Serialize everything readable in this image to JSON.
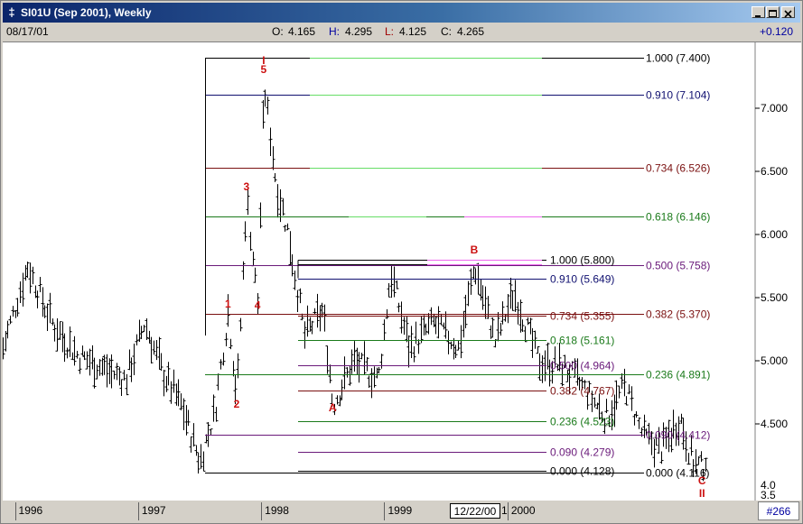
{
  "window": {
    "icon_glyph": "‡",
    "title": "SI01U (Sep 2001), Weekly",
    "buttons": [
      "minimize",
      "maximize",
      "close"
    ]
  },
  "status": {
    "date": "08/17/01",
    "open_label": "O:",
    "open": "4.165",
    "high_label": "H:",
    "high": "4.295",
    "low_label": "L:",
    "low": "4.125",
    "close_label": "C:",
    "close": "4.265",
    "change": "+0.120"
  },
  "bottom": {
    "years": [
      "1996",
      "1997",
      "1998",
      "1999",
      "2000"
    ],
    "cursor_date": "12/22/00",
    "after_cursor": "1",
    "bar_count": "#266"
  },
  "colors": {
    "fib_green": "#1a7a1a",
    "fib_purple": "#6a1a7a",
    "fib_maroon": "#7a1010",
    "fib_navy": "#101070",
    "wave_label": "#cc1010",
    "highlight_green": "#66dd66",
    "highlight_magenta": "#ee66ee"
  },
  "chart_data": {
    "type": "ohlc",
    "ylim": [
      4.0,
      7.4
    ],
    "y_ticks": [
      "7.000",
      "6.500",
      "6.000",
      "5.500",
      "5.000",
      "4.500"
    ],
    "y_tick_values": [
      7.0,
      6.5,
      6.0,
      5.5,
      5.0,
      4.5
    ],
    "y_bottom_cut": [
      "4.0",
      "3.5"
    ],
    "x_labels": [
      "1996",
      "1997",
      "1998",
      "1999",
      "2000",
      "12/22/00"
    ],
    "wave_labels": [
      {
        "text": "1",
        "date": "1997.73",
        "price": 5.42
      },
      {
        "text": "2",
        "date": "1997.80",
        "price": 4.63
      },
      {
        "text": "3",
        "date": "1997.88",
        "price": 6.35
      },
      {
        "text": "4",
        "date": "1997.97",
        "price": 5.41
      },
      {
        "text": "5",
        "date": "1998.02",
        "price": 7.28
      },
      {
        "text": "I",
        "date": "1998.02",
        "price": 7.35
      },
      {
        "text": "A",
        "date": "1998.58",
        "price": 4.6
      },
      {
        "text": "B",
        "date": "1999.73",
        "price": 5.85
      },
      {
        "text": "C",
        "date": "2001.58",
        "price": 4.02
      },
      {
        "text": "II",
        "date": "2001.58",
        "price": 3.92
      }
    ],
    "fib_set_major": [
      {
        "ratio": "1.000",
        "price": "7.400",
        "value": 7.4,
        "color": "black"
      },
      {
        "ratio": "0.910",
        "price": "7.104",
        "value": 7.104,
        "color": "navy"
      },
      {
        "ratio": "0.734",
        "price": "6.526",
        "value": 6.526,
        "color": "maroon"
      },
      {
        "ratio": "0.618",
        "price": "6.146",
        "value": 6.146,
        "color": "green"
      },
      {
        "ratio": "0.500",
        "price": "5.758",
        "value": 5.758,
        "color": "purple"
      },
      {
        "ratio": "0.382",
        "price": "5.370",
        "value": 5.37,
        "color": "maroon"
      },
      {
        "ratio": "0.236",
        "price": "4.891",
        "value": 4.891,
        "color": "green"
      },
      {
        "ratio": "0.090",
        "price": "4.412",
        "value": 4.412,
        "color": "purple"
      },
      {
        "ratio": "0.000",
        "price": "4.116",
        "value": 4.116,
        "color": "black"
      }
    ],
    "fib_set_minor": [
      {
        "ratio": "1.000",
        "price": "5.800",
        "value": 5.8,
        "color": "black"
      },
      {
        "ratio": "0.910",
        "price": "5.649",
        "value": 5.649,
        "color": "navy"
      },
      {
        "ratio": "0.734",
        "price": "5.355",
        "value": 5.355,
        "color": "maroon"
      },
      {
        "ratio": "0.618",
        "price": "5.161",
        "value": 5.161,
        "color": "green"
      },
      {
        "ratio": "0.500",
        "price": "4.964",
        "value": 4.964,
        "color": "purple"
      },
      {
        "ratio": "0.382",
        "price": "4.767",
        "value": 4.767,
        "color": "maroon"
      },
      {
        "ratio": "0.236",
        "price": "4.523",
        "value": 4.523,
        "color": "green"
      },
      {
        "ratio": "0.090",
        "price": "4.279",
        "value": 4.279,
        "color": "purple"
      },
      {
        "ratio": "0.000",
        "price": "4.128",
        "value": 4.128,
        "color": "black"
      }
    ],
    "price_path": [
      {
        "t": 1995.9,
        "p": 5.1
      },
      {
        "t": 1996.1,
        "p": 5.75
      },
      {
        "t": 1996.3,
        "p": 5.3
      },
      {
        "t": 1996.5,
        "p": 5.05
      },
      {
        "t": 1996.7,
        "p": 4.95
      },
      {
        "t": 1996.9,
        "p": 4.85
      },
      {
        "t": 1997.05,
        "p": 5.3
      },
      {
        "t": 1997.2,
        "p": 4.9
      },
      {
        "t": 1997.35,
        "p": 4.65
      },
      {
        "t": 1997.5,
        "p": 4.2
      },
      {
        "t": 1997.62,
        "p": 4.6
      },
      {
        "t": 1997.73,
        "p": 5.4
      },
      {
        "t": 1997.8,
        "p": 4.7
      },
      {
        "t": 1997.88,
        "p": 6.3
      },
      {
        "t": 1997.97,
        "p": 5.45
      },
      {
        "t": 1998.02,
        "p": 7.2
      },
      {
        "t": 1998.12,
        "p": 6.4
      },
      {
        "t": 1998.22,
        "p": 6.0
      },
      {
        "t": 1998.35,
        "p": 5.2
      },
      {
        "t": 1998.5,
        "p": 5.4
      },
      {
        "t": 1998.58,
        "p": 4.65
      },
      {
        "t": 1998.75,
        "p": 5.0
      },
      {
        "t": 1998.95,
        "p": 4.85
      },
      {
        "t": 1999.05,
        "p": 5.7
      },
      {
        "t": 1999.2,
        "p": 5.1
      },
      {
        "t": 1999.4,
        "p": 5.3
      },
      {
        "t": 1999.6,
        "p": 5.1
      },
      {
        "t": 1999.73,
        "p": 5.75
      },
      {
        "t": 1999.9,
        "p": 5.15
      },
      {
        "t": 2000.05,
        "p": 5.55
      },
      {
        "t": 2000.25,
        "p": 5.0
      },
      {
        "t": 2000.45,
        "p": 4.95
      },
      {
        "t": 2000.6,
        "p": 4.8
      },
      {
        "t": 2000.8,
        "p": 4.55
      },
      {
        "t": 2000.95,
        "p": 4.8
      },
      {
        "t": 2001.1,
        "p": 4.4
      },
      {
        "t": 2001.25,
        "p": 4.3
      },
      {
        "t": 2001.4,
        "p": 4.55
      },
      {
        "t": 2001.5,
        "p": 4.2
      },
      {
        "t": 2001.58,
        "p": 4.15
      },
      {
        "t": 2001.62,
        "p": 4.265
      }
    ]
  }
}
